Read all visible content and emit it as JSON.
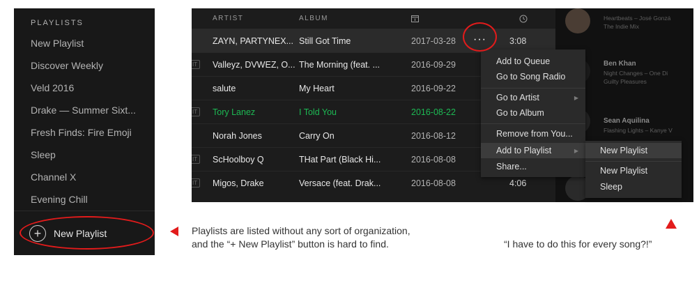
{
  "sidebar": {
    "heading": "PLAYLISTS",
    "playlists": [
      "New Playlist",
      "Discover Weekly",
      "Veld 2016",
      "Drake — Summer Sixt...",
      "Fresh Finds: Fire Emoji",
      "Sleep",
      "Channel X",
      "Evening Chill"
    ],
    "new_playlist_button": "New Playlist"
  },
  "tracklist": {
    "headers": {
      "artist": "ARTIST",
      "album": "ALBUM"
    },
    "date_icon": "calendar-icon",
    "duration_icon": "clock-icon",
    "explicit_label": "IT",
    "more_label": "···",
    "rows": [
      {
        "artist": "ZAYN, PARTYNEX...",
        "album": "Still Got Time",
        "date": "2017-03-28",
        "duration": "3:08"
      },
      {
        "artist": "Valleyz, DVWEZ, O...",
        "album": "The Morning (feat. ...",
        "date": "2016-09-29",
        "duration": ""
      },
      {
        "artist": "salute",
        "album": "My Heart",
        "date": "2016-09-22",
        "duration": ""
      },
      {
        "artist": "Tory Lanez",
        "album": "I Told You",
        "date": "2016-08-22",
        "duration": ""
      },
      {
        "artist": "Norah Jones",
        "album": "Carry On",
        "date": "2016-08-12",
        "duration": ""
      },
      {
        "artist": "ScHoolboy Q",
        "album": "THat Part (Black Hi...",
        "date": "2016-08-08",
        "duration": ""
      },
      {
        "artist": "Migos, Drake",
        "album": "Versace (feat. Drak...",
        "date": "2016-08-08",
        "duration": "4:06"
      }
    ],
    "playing_color": "#1db954"
  },
  "friends": [
    {
      "name": "",
      "track": "Heartbeats – José Gonzá",
      "context": "The Indie Mix"
    },
    {
      "name": "Ben Khan",
      "track": "Night Changes – One Di",
      "context": "Guilty Pleasures"
    },
    {
      "name": "Sean Aquilina",
      "track": "Flashing Lights – Kanye V",
      "context": ""
    }
  ],
  "context_menu": {
    "items": [
      "Add to Queue",
      "Go to Song Radio",
      "Go to Artist",
      "Go to Album",
      "Remove from You...",
      "Add to Playlist",
      "Share..."
    ]
  },
  "submenu": {
    "items": [
      "New Playlist",
      "New Playlist",
      "Sleep"
    ]
  },
  "annotations": {
    "left_caption_line1": "Playlists are listed without any sort of organization,",
    "left_caption_line2": "and the “+ New Playlist” button is hard to find.",
    "right_caption": "“I have to do this for every song?!”",
    "accent_color": "#e21b1b"
  }
}
